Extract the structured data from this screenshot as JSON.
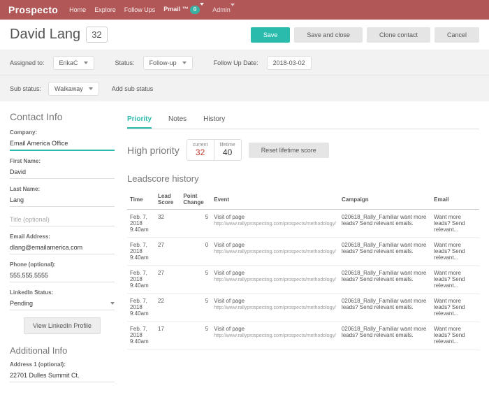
{
  "nav": {
    "brand": "Prospecto",
    "items": [
      "Home",
      "Explore",
      "Follow Ups"
    ],
    "pmail": "Pmail ™",
    "pmail_badge": "0",
    "admin": "Admin"
  },
  "header": {
    "name": "David Lang",
    "score": "32",
    "buttons": {
      "save": "Save",
      "save_close": "Save and close",
      "clone": "Clone contact",
      "cancel": "Cancel"
    }
  },
  "filters": {
    "assigned_label": "Assigned to:",
    "assigned_value": "ErikaC",
    "status_label": "Status:",
    "status_value": "Follow-up",
    "followup_label": "Follow Up Date:",
    "followup_value": "2018-03-02",
    "sub_label": "Sub status:",
    "sub_value": "Walkaway",
    "add_sub": "Add sub status"
  },
  "contact": {
    "title": "Contact Info",
    "company_l": "Company:",
    "company_v": "Email America Office",
    "first_l": "First Name:",
    "first_v": "David",
    "last_l": "Last Name:",
    "last_v": "Lang",
    "title_l": "Title (optional)",
    "title_v": "",
    "email_l": "Email Address:",
    "email_v": "dlang@emailamerica.com",
    "phone_l": "Phone (optional):",
    "phone_v": "555.555.5555",
    "li_l": "LinkedIn Status:",
    "li_v": "Pending",
    "li_btn": "View LinkedIn Profile",
    "additional": "Additional Info",
    "addr_l": "Address 1 (optional):",
    "addr_v": "22701 Dulles Summit Ct."
  },
  "tabs": {
    "priority": "Priority",
    "notes": "Notes",
    "history": "History"
  },
  "priority": {
    "heading": "High priority",
    "current_l": "current",
    "current_v": "32",
    "lifetime_l": "lifetime",
    "lifetime_v": "40",
    "reset": "Reset lifetime score"
  },
  "history": {
    "title": "Leadscore history",
    "cols": [
      "Time",
      "Lead Score",
      "Point Change",
      "Event",
      "Campaign",
      "Email"
    ],
    "rows": [
      {
        "time": "Feb. 7, 2018",
        "time2": "9:40am",
        "score": "32",
        "change": "5",
        "event": "Visit of page",
        "url": "http://www.rallyprospecting.com/prospects/methodology/",
        "campaign": "020618_Rally_Familiar want more leads? Send relevant emails.",
        "email": "Want more leads? Send relevant..."
      },
      {
        "time": "Feb. 7, 2018",
        "time2": "9:40am",
        "score": "27",
        "change": "0",
        "event": "Visit of page",
        "url": "http://www.rallyprospecting.com/prospects/methodology/",
        "campaign": "020618_Rally_Familiar want more leads? Send relevant emails.",
        "email": "Want more leads? Send relevant..."
      },
      {
        "time": "Feb. 7, 2018",
        "time2": "9:40am",
        "score": "27",
        "change": "5",
        "event": "Visit of page",
        "url": "http://www.rallyprospecting.com/prospects/methodology/",
        "campaign": "020618_Rally_Familiar want more leads? Send relevant emails.",
        "email": "Want more leads? Send relevant..."
      },
      {
        "time": "Feb. 7, 2018",
        "time2": "9:40am",
        "score": "22",
        "change": "5",
        "event": "Visit of page",
        "url": "http://www.rallyprospecting.com/prospects/methodology/",
        "campaign": "020618_Rally_Familiar want more leads? Send relevant emails.",
        "email": "Want more leads? Send relevant..."
      },
      {
        "time": "Feb. 7, 2018",
        "time2": "9:40am",
        "score": "17",
        "change": "5",
        "event": "Visit of page",
        "url": "http://www.rallyprospecting.com/prospects/methodology/",
        "campaign": "020618_Rally_Familiar want more leads? Send relevant emails.",
        "email": "Want more leads? Send relevant..."
      }
    ]
  }
}
